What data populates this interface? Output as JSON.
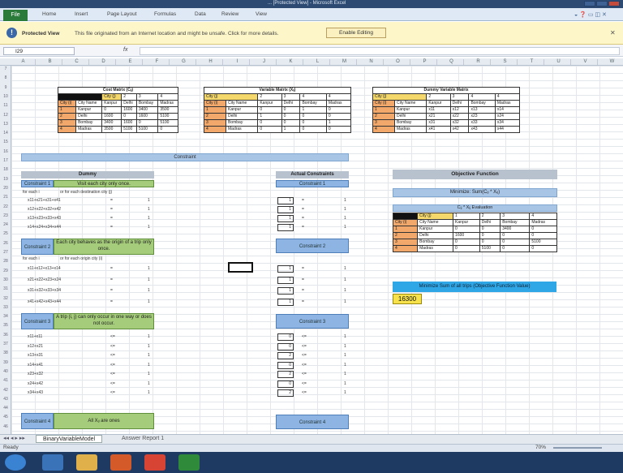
{
  "window": {
    "title": "... [Protected View] - Microsoft Excel"
  },
  "ribbon": {
    "file": "File",
    "tabs": [
      "Home",
      "Insert",
      "Page Layout",
      "Formulas",
      "Data",
      "Review",
      "View"
    ]
  },
  "protected": {
    "title": "Protected View",
    "message": "This file originated from an Internet location and might be unsafe. Click for more details.",
    "button": "Enable Editing"
  },
  "formula": {
    "namebox": "I29",
    "fx": "fx",
    "value": ""
  },
  "columns": [
    "A",
    "B",
    "C",
    "D",
    "E",
    "F",
    "G",
    "H",
    "I",
    "J",
    "K",
    "L",
    "M",
    "N",
    "O",
    "P",
    "Q",
    "R",
    "S",
    "T",
    "U",
    "V",
    "W"
  ],
  "rows": [
    "7",
    "8",
    "9",
    "10",
    "11",
    "12",
    "13",
    "14",
    "15",
    "16",
    "17",
    "18",
    "19",
    "20",
    "21",
    "22",
    "23",
    "24",
    "25",
    "26",
    "27",
    "28",
    "29",
    "30",
    "31",
    "32",
    "33",
    "34",
    "35",
    "36",
    "37",
    "38",
    "39",
    "40",
    "41",
    "42",
    "43",
    "44",
    "45",
    "46"
  ],
  "cost": {
    "title": "Cost Matrix (Cᵢⱼ)",
    "city_j": "City (j)",
    "nums": [
      "1",
      "2",
      "3",
      "4"
    ],
    "city_i": "City (i)",
    "city_name": "City Name",
    "names": [
      "Kanpur",
      "Delhi",
      "Bombay",
      "Madras"
    ],
    "rows": [
      [
        "1",
        "Kanpur",
        "0",
        "1600",
        "3400",
        "3500"
      ],
      [
        "2",
        "Delhi",
        "1600",
        "0",
        "1600",
        "5100"
      ],
      [
        "3",
        "Bombay",
        "3400",
        "1600",
        "0",
        "5100"
      ],
      [
        "4",
        "Madras",
        "3500",
        "5100",
        "5100",
        "0"
      ]
    ]
  },
  "variable": {
    "title": "Variable Matrix (Xᵢⱼ)",
    "rows": [
      [
        "1",
        "Kanpur",
        "0",
        "0",
        "1",
        "0"
      ],
      [
        "2",
        "Delhi",
        "1",
        "0",
        "0",
        "0"
      ],
      [
        "3",
        "Bombay",
        "0",
        "0",
        "0",
        "1"
      ],
      [
        "4",
        "Madras",
        "0",
        "1",
        "0",
        "0"
      ]
    ]
  },
  "dummy_matrix": {
    "title": "Dummy Variable Matrix",
    "rows": [
      [
        "1",
        "Kanpur",
        "x11",
        "x12",
        "x13",
        "x14"
      ],
      [
        "2",
        "Delhi",
        "x21",
        "x22",
        "x23",
        "x24"
      ],
      [
        "3",
        "Bombay",
        "x31",
        "x32",
        "x33",
        "x34"
      ],
      [
        "4",
        "Madras",
        "x41",
        "x42",
        "x43",
        "x44"
      ]
    ]
  },
  "constraint_bar": "Constraint",
  "dummy": {
    "title": "Dummy",
    "actual_title": "Actual Constraints",
    "c1": {
      "label": "Constraint 1",
      "desc": "Visit each city only once.",
      "left": "for each i",
      "right": "or for each destination city (j)",
      "rows": [
        "x11+x21+x31+x41",
        "x12+x22+x32+x42",
        "x13+x23+x33+x43",
        "x14+x24+x34+x44"
      ],
      "op": "=",
      "rhs": "1"
    },
    "c2": {
      "label": "Constraint 2",
      "desc": "Each city behaves as the origin of a trip only once.",
      "left": "for each i",
      "right": "or for each origin city (i)",
      "rows": [
        "x11+x12+x13+x14",
        "x21+x22+x23+x24",
        "x31+x32+x33+x34",
        "x41+x42+x43+x44"
      ],
      "op": "=",
      "rhs": "1"
    },
    "c3": {
      "label": "Constraint 3",
      "desc": "A trip (i, j) can only occur in one way or does not occur.",
      "rows": [
        "x11+x11",
        "x12+x21",
        "x13+x31",
        "x14+x41",
        "x23+x32",
        "x24+x42",
        "x34+x43"
      ],
      "op": "<=",
      "rhs": "1"
    },
    "c4": {
      "label": "Constraint 4",
      "desc": "All Xᵢⱼ are ones"
    },
    "actual_vals1": [
      "1",
      "1",
      "1",
      "1"
    ],
    "actual_vals2": [
      "1",
      "1",
      "1",
      "1"
    ],
    "actual_vals3": [
      "0",
      "0",
      "2",
      "0",
      "2",
      "0",
      "2"
    ]
  },
  "objective": {
    "title": "Objective Function",
    "minimize": "Minimize: Sum(Cᵢⱼ * Xᵢⱼ)",
    "eval_title": "Cᵢⱼ * Xᵢⱼ Evaluation",
    "rows": [
      [
        "1",
        "Kanpur",
        "0",
        "0",
        "3400",
        "0"
      ],
      [
        "2",
        "Delhi",
        "1600",
        "0",
        "0",
        "0"
      ],
      [
        "3",
        "Bombay",
        "0",
        "0",
        "0",
        "5100"
      ],
      [
        "4",
        "Madras",
        "0",
        "5100",
        "0",
        "0"
      ]
    ],
    "sum_label": "Minimize Sum of all trips (Objective Function Value)",
    "value": "16300"
  },
  "sheets": [
    "BinaryVariableModel",
    "Answer Report 1"
  ],
  "status": {
    "ready": "Ready",
    "zoom": "70%"
  }
}
